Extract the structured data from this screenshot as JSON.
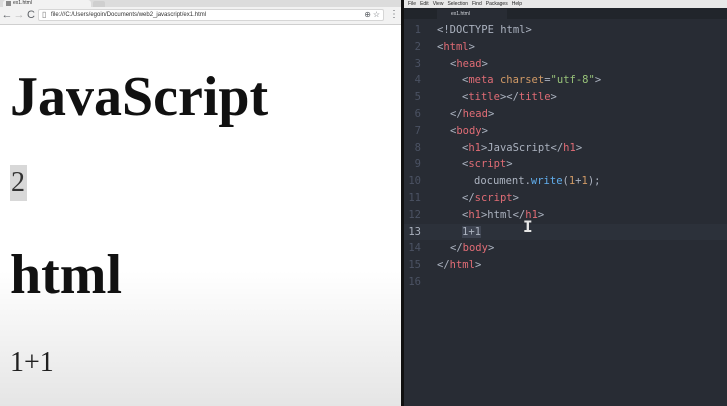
{
  "browser": {
    "tab": {
      "title": "ex1.html"
    },
    "nav": {
      "back": "←",
      "forward": "→",
      "reload": "C"
    },
    "address": {
      "url": "file:///C:/Users/egoin/Documents/web2_javascript/ex1.html"
    },
    "toolbar": {
      "zoom_glyph": "⊕",
      "star_glyph": "☆",
      "menu_glyph": "⋮"
    },
    "page": {
      "heading1": "JavaScript",
      "script_output": "2",
      "heading2": "html",
      "text": "1+1"
    }
  },
  "editor": {
    "menu": [
      "File",
      "Edit",
      "View",
      "Selection",
      "Find",
      "Packages",
      "Help"
    ],
    "tab": {
      "filename": "ex1.html"
    },
    "lines": [
      {
        "n": "1",
        "indent": 0,
        "tokens": [
          [
            "p",
            "<!DOCTYPE html>"
          ]
        ]
      },
      {
        "n": "2",
        "indent": 0,
        "tokens": [
          [
            "p",
            "<"
          ],
          [
            "tag",
            "html"
          ],
          [
            "p",
            ">"
          ]
        ]
      },
      {
        "n": "3",
        "indent": 1,
        "tokens": [
          [
            "p",
            "<"
          ],
          [
            "tag",
            "head"
          ],
          [
            "p",
            ">"
          ]
        ]
      },
      {
        "n": "4",
        "indent": 2,
        "tokens": [
          [
            "p",
            "<"
          ],
          [
            "tag",
            "meta"
          ],
          [
            "p",
            " "
          ],
          [
            "attr",
            "charset"
          ],
          [
            "p",
            "="
          ],
          [
            "str",
            "\"utf-8\""
          ],
          [
            "p",
            ">"
          ]
        ]
      },
      {
        "n": "5",
        "indent": 2,
        "tokens": [
          [
            "p",
            "<"
          ],
          [
            "tag",
            "title"
          ],
          [
            "p",
            "></"
          ],
          [
            "tag",
            "title"
          ],
          [
            "p",
            ">"
          ]
        ]
      },
      {
        "n": "6",
        "indent": 1,
        "tokens": [
          [
            "p",
            "</"
          ],
          [
            "tag",
            "head"
          ],
          [
            "p",
            ">"
          ]
        ]
      },
      {
        "n": "7",
        "indent": 1,
        "tokens": [
          [
            "p",
            "<"
          ],
          [
            "tag",
            "body"
          ],
          [
            "p",
            ">"
          ]
        ]
      },
      {
        "n": "8",
        "indent": 2,
        "tokens": [
          [
            "p",
            "<"
          ],
          [
            "tag",
            "h1"
          ],
          [
            "p",
            ">JavaScript</"
          ],
          [
            "tag",
            "h1"
          ],
          [
            "p",
            ">"
          ]
        ]
      },
      {
        "n": "9",
        "indent": 2,
        "tokens": [
          [
            "p",
            "<"
          ],
          [
            "tag",
            "script"
          ],
          [
            "p",
            ">"
          ]
        ]
      },
      {
        "n": "10",
        "indent": 3,
        "tokens": [
          [
            "p",
            "document."
          ],
          [
            "fn",
            "write"
          ],
          [
            "p",
            "("
          ],
          [
            "num",
            "1"
          ],
          [
            "p",
            "+"
          ],
          [
            "num",
            "1"
          ],
          [
            "p",
            ");"
          ]
        ]
      },
      {
        "n": "11",
        "indent": 2,
        "tokens": [
          [
            "p",
            "</"
          ],
          [
            "tag",
            "script"
          ],
          [
            "p",
            ">"
          ]
        ]
      },
      {
        "n": "12",
        "indent": 2,
        "tokens": [
          [
            "p",
            "<"
          ],
          [
            "tag",
            "h1"
          ],
          [
            "p",
            ">html</"
          ],
          [
            "tag",
            "h1"
          ],
          [
            "p",
            ">"
          ]
        ]
      },
      {
        "n": "13",
        "indent": 2,
        "active": true,
        "tokens": [
          [
            "sel",
            "1+1"
          ]
        ]
      },
      {
        "n": "14",
        "indent": 1,
        "tokens": [
          [
            "p",
            "</"
          ],
          [
            "tag",
            "body"
          ],
          [
            "p",
            ">"
          ]
        ]
      },
      {
        "n": "15",
        "indent": 0,
        "tokens": [
          [
            "p",
            "</"
          ],
          [
            "tag",
            "html"
          ],
          [
            "p",
            ">"
          ]
        ]
      },
      {
        "n": "16",
        "indent": 0,
        "tokens": []
      }
    ],
    "colors": {
      "background": "#282c34",
      "tag": "#e06c75",
      "attribute": "#d19a66",
      "string": "#98c379",
      "function": "#61afef",
      "number": "#d19a66",
      "plain": "#abb2bf",
      "gutter": "#4b5263"
    },
    "cursor_glyph": "I"
  }
}
